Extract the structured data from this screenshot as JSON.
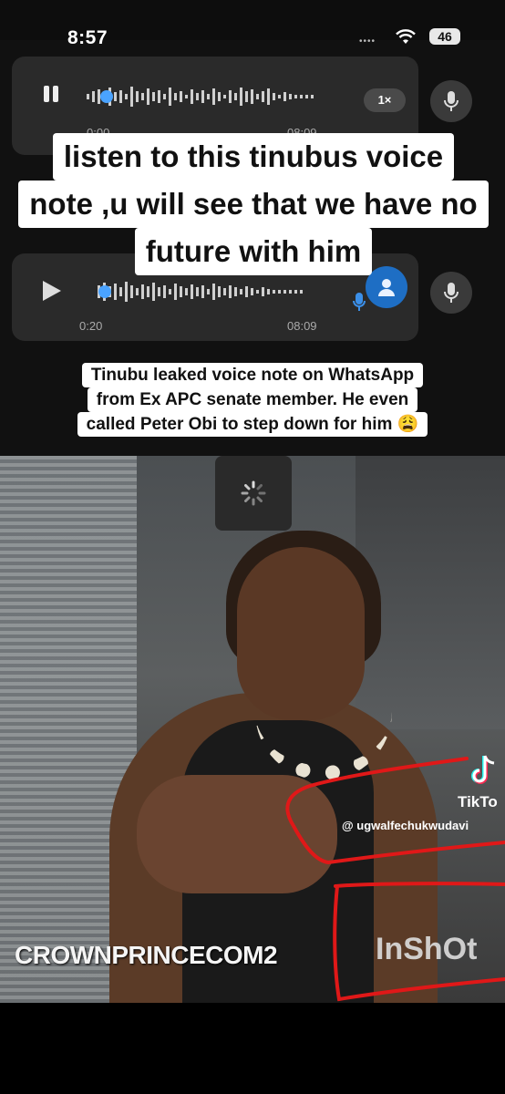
{
  "status_bar": {
    "time": "8:57",
    "signal": "••••",
    "battery": "46",
    "icons": [
      "wifi-icon",
      "battery-icon"
    ]
  },
  "voice_note_1": {
    "speed": "1×",
    "elapsed": "0:00",
    "duration": "08:09",
    "state": "playing"
  },
  "voice_note_2": {
    "elapsed": "0:20",
    "duration": "08:09",
    "state": "paused"
  },
  "caption_top": {
    "line1": "listen to this tinubus voice",
    "line2": "note ,u will see that we have no",
    "line3": "future with him"
  },
  "caption_middle": {
    "line1": "Tinubu leaked voice note on WhatsApp",
    "line2": "from Ex APC senate member. He even",
    "line3": "called Peter Obi to step down for him 😩"
  },
  "video": {
    "watermark_left": "CROWNPRINCECOM2",
    "watermark_right": "InShOt",
    "tiktok_label": "TikTo",
    "tiktok_user": "@ ugwalfechukwudavi"
  },
  "colors": {
    "card_bg": "#2a2a2a",
    "accent_blue": "#1e6ec4",
    "annotation_red": "#e01818"
  }
}
